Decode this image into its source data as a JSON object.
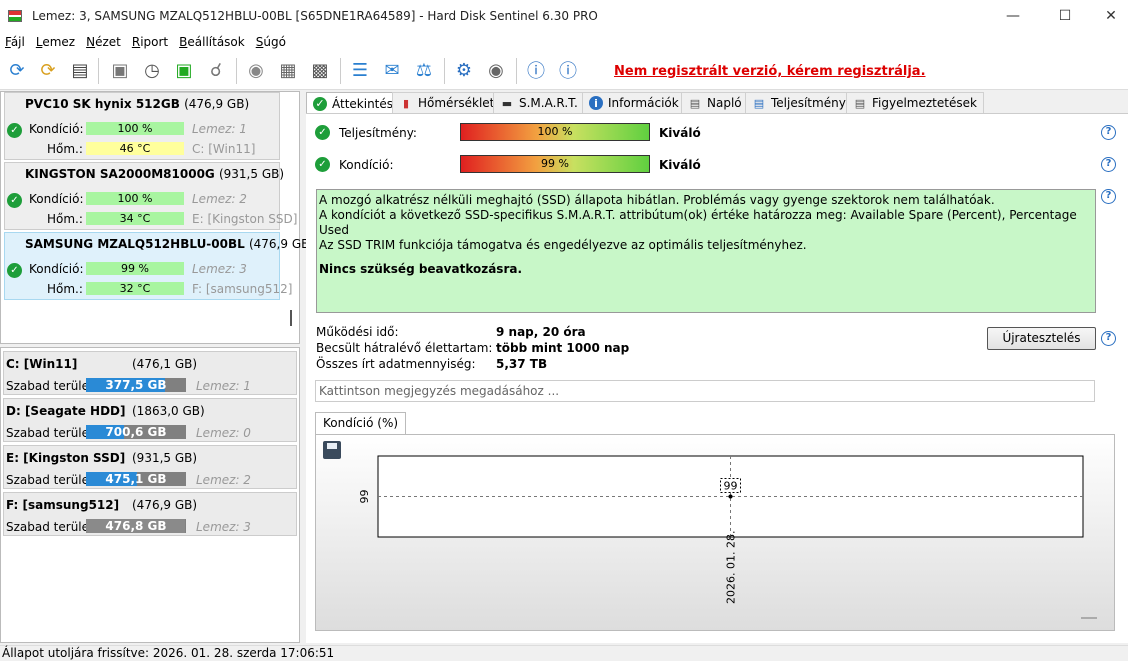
{
  "window": {
    "title": "Lemez: 3, SAMSUNG MZALQ512HBLU-00BL [S65DNE1RA64589]  -  Hard Disk Sentinel 6.30 PRO"
  },
  "menu": [
    "Fájl",
    "Lemez",
    "Nézet",
    "Riport",
    "Beállítások",
    "Súgó"
  ],
  "register_link": "Nem regisztrált verzió, kérem regisztrálja.",
  "disks": [
    {
      "name": "PVC10 SK hynix 512GB",
      "size": "(476,9 GB)",
      "condition_label": "Kondíció:",
      "condition": "100 %",
      "condition_pct": 100,
      "temp_label": "Hőm.:",
      "temp": "46 °C",
      "disk_ref": "Lemez: 1",
      "drive_ref": "C: [Win11]",
      "temp_color": "yellow"
    },
    {
      "name": "KINGSTON SA2000M81000G",
      "size": "(931,5 GB)",
      "condition_label": "Kondíció:",
      "condition": "100 %",
      "condition_pct": 100,
      "temp_label": "Hőm.:",
      "temp": "34 °C",
      "disk_ref": "Lemez: 2",
      "drive_ref": "E: [Kingston SSD]",
      "temp_color": "green"
    },
    {
      "name": "SAMSUNG MZALQ512HBLU-00BL",
      "size": "(476,9 GB)",
      "condition_label": "Kondíció:",
      "condition": "99 %",
      "condition_pct": 99,
      "temp_label": "Hőm.:",
      "temp": "32 °C",
      "disk_ref": "Lemez: 3",
      "drive_ref": "F: [samsung512]",
      "temp_color": "green"
    }
  ],
  "partitions": [
    {
      "name": "C: [Win11]",
      "size": "(476,1 GB)",
      "free_label": "Szabad terület",
      "free": "377,5 GB",
      "free_pct": 79,
      "disk_ref": "Lemez: 1"
    },
    {
      "name": "D: [Seagate HDD]",
      "size": "(1863,0 GB)",
      "free_label": "Szabad terület",
      "free": "700,6 GB",
      "free_pct": 38,
      "disk_ref": "Lemez: 0"
    },
    {
      "name": "E: [Kingston SSD]",
      "size": "(931,5 GB)",
      "free_label": "Szabad terület",
      "free": "475,1 GB",
      "free_pct": 51,
      "disk_ref": "Lemez: 2"
    },
    {
      "name": "F: [samsung512]",
      "size": "(476,9 GB)",
      "free_label": "Szabad terület",
      "free": "476,8 GB",
      "free_pct": 99,
      "disk_ref": "Lemez: 3"
    }
  ],
  "tabs": [
    {
      "label": "Áttekintés",
      "icon": "check-icon"
    },
    {
      "label": "Hőmérséklet",
      "icon": "thermometer-icon"
    },
    {
      "label": "S.M.A.R.T.",
      "icon": "smart-icon"
    },
    {
      "label": "Információk",
      "icon": "info-icon"
    },
    {
      "label": "Napló",
      "icon": "log-icon"
    },
    {
      "label": "Teljesítmény",
      "icon": "performance-icon"
    },
    {
      "label": "Figyelmeztetések",
      "icon": "alerts-icon"
    }
  ],
  "overview": {
    "performance_label": "Teljesítmény:",
    "performance": "100 %",
    "performance_verdict": "Kiváló",
    "condition_label": "Kondíció:",
    "condition": "99 %",
    "condition_verdict": "Kiváló",
    "summary": [
      "A mozgó alkatrész nélküli meghajtó (SSD) állapota hibátlan. Problémás vagy gyenge szektorok nem találhatóak.",
      "A kondíciót a következő SSD-specifikus S.M.A.R.T. attribútum(ok) értéke határozza meg:  Available Spare (Percent), Percentage Used",
      "Az SSD TRIM funkciója támogatva és engedélyezve az optimális teljesítményhez."
    ],
    "summary_action": "Nincs szükség beavatkozásra.",
    "uptime_label": "Működési idő:",
    "uptime": "9 nap, 20 óra",
    "lifetime_label": "Becsült hátralévő élettartam:",
    "lifetime": "több mint 1000 nap",
    "written_label": "Összes írt adatmennyiség:",
    "written": "5,37 TB",
    "retest_button": "Újratesztelés",
    "note_placeholder": "Kattintson megjegyzés megadásához ..."
  },
  "chart_tab": "Kondíció  (%)",
  "chart_data": {
    "type": "line",
    "x": [
      "2026. 01. 28."
    ],
    "values": [
      99
    ],
    "y_tick_labels": [
      "99"
    ],
    "data_labels": [
      "99"
    ]
  },
  "status": "Állapot utoljára frissítve: 2026. 01. 28. szerda 17:06:51"
}
